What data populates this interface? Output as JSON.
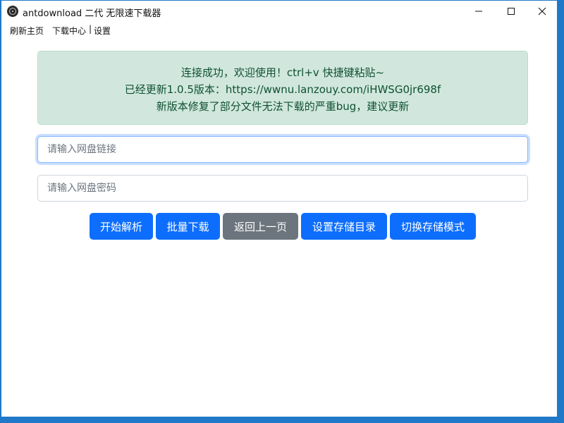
{
  "window": {
    "title": "antdownload 二代 无限速下载器"
  },
  "menu": {
    "items": [
      "刷新主页",
      "下载中心",
      "设置"
    ],
    "separator": "|"
  },
  "alert": {
    "lines": [
      "连接成功，欢迎使用！ctrl+v 快捷键粘贴~",
      "已经更新1.0.5版本：https://wwnu.lanzouy.com/iHWSG0jr698f",
      "新版本修复了部分文件无法下载的严重bug，建议更新"
    ]
  },
  "inputs": {
    "link": {
      "value": "",
      "placeholder": "请输入网盘链接"
    },
    "password": {
      "value": "",
      "placeholder": "请输入网盘密码"
    }
  },
  "buttons": [
    "开始解析",
    "批量下载",
    "返回上一页",
    "设置存储目录",
    "切换存储模式"
  ],
  "colors": {
    "primary": "#0d6efd",
    "secondary": "#6c757d",
    "alert_bg": "#d1e7dd",
    "alert_text": "#0f5132",
    "desktop": "#1f78c8"
  },
  "icons": {
    "app": "electron-app-icon",
    "minimize": "minimize-icon",
    "maximize": "maximize-icon",
    "close": "close-icon"
  }
}
